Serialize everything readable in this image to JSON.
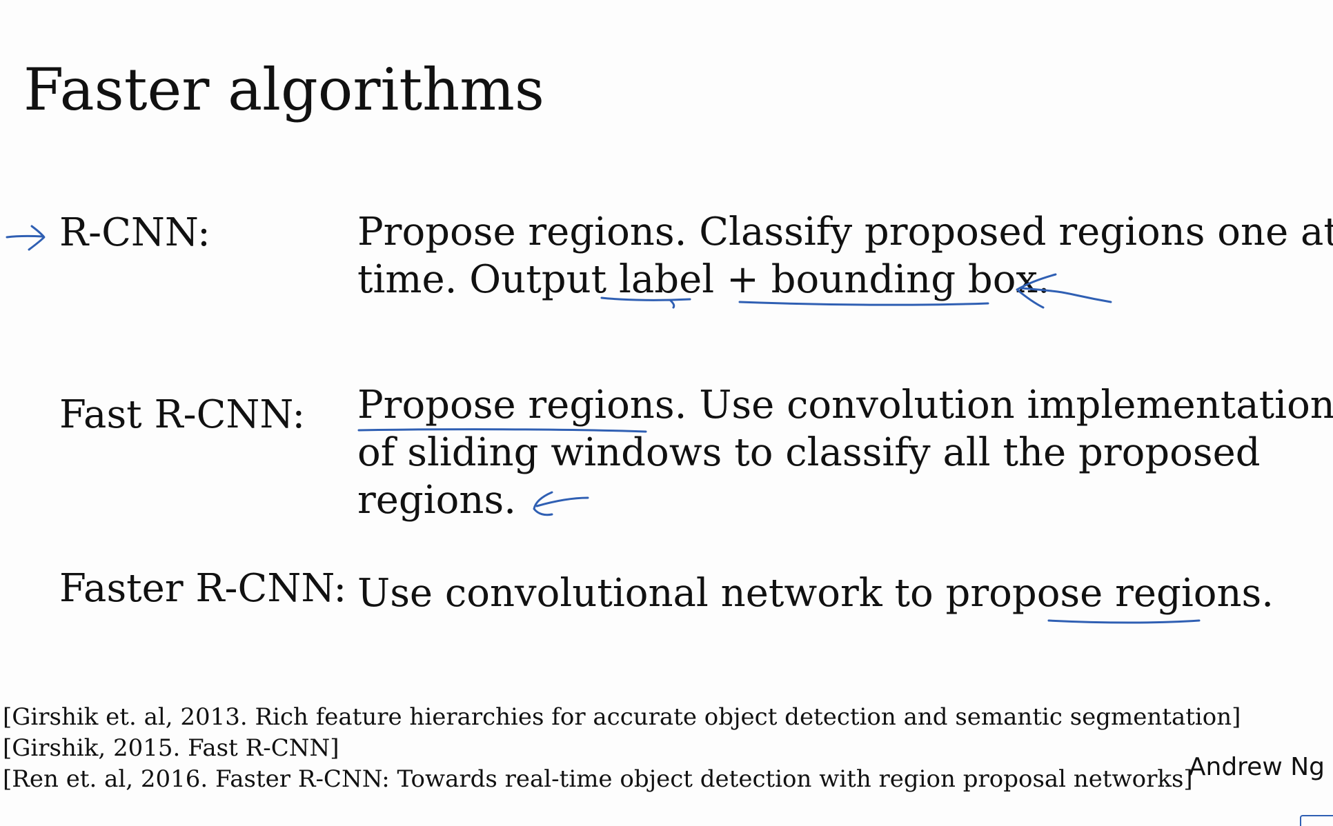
{
  "slide": {
    "title": "Faster algorithms",
    "rows": [
      {
        "label": "R-CNN:",
        "desc_lines": [
          "Propose regions. Classify proposed regions one at a",
          "time. Output label + bounding box."
        ]
      },
      {
        "label": "Fast R-CNN:",
        "desc_lines": [
          "Propose regions. Use convolution implementation",
          "of sliding windows to classify all the proposed",
          "regions."
        ]
      },
      {
        "label": "Faster R-CNN:",
        "desc_lines": [
          "Use convolutional network to propose regions."
        ]
      }
    ],
    "references": [
      "[Girshik et. al, 2013. Rich feature hierarchies for accurate object detection and semantic segmentation]",
      "[Girshik, 2015. Fast R-CNN]",
      "[Ren et. al, 2016. Faster R-CNN: Towards real-time object detection with region proposal networks]"
    ],
    "author": "Andrew Ng"
  },
  "annotations": {
    "ink_color": "#2f5fb3",
    "marks": [
      "arrow-right-icon",
      "underline",
      "arrow-left-icon"
    ]
  }
}
